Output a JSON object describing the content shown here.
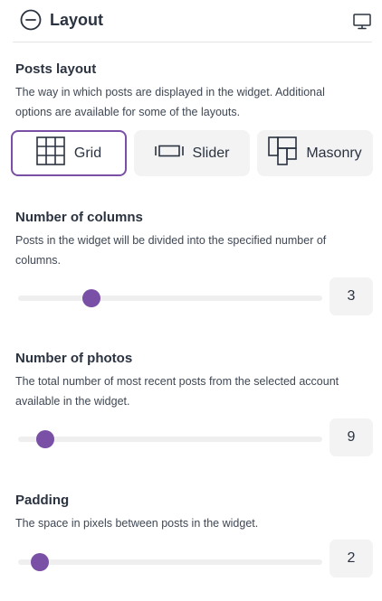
{
  "header": {
    "title": "Layout",
    "collapse_icon": "minus-circle-icon",
    "device_icon": "desktop-monitor-icon"
  },
  "posts_layout": {
    "title": "Posts layout",
    "description": "The way in which posts are displayed in the widget. Additional options are available for some of the layouts.",
    "options": [
      {
        "label": "Grid",
        "icon": "grid-icon",
        "selected": true
      },
      {
        "label": "Slider",
        "icon": "slider-icon",
        "selected": false
      },
      {
        "label": "Masonry",
        "icon": "masonry-icon",
        "selected": false
      }
    ]
  },
  "columns": {
    "title": "Number of columns",
    "description": "Posts in the widget will be divided into the specified number of columns.",
    "value": "3",
    "slider_fraction": 0.24
  },
  "photos": {
    "title": "Number of photos",
    "description": "The total number of most recent posts from the selected account available in the widget.",
    "value": "9",
    "slider_fraction": 0.09
  },
  "padding": {
    "title": "Padding",
    "description": "The space in pixels between posts in the widget.",
    "value": "2",
    "slider_fraction": 0.07
  },
  "colors": {
    "accent": "#7a4fa6",
    "text": "#2b3340",
    "control_bg": "#f3f3f4"
  }
}
